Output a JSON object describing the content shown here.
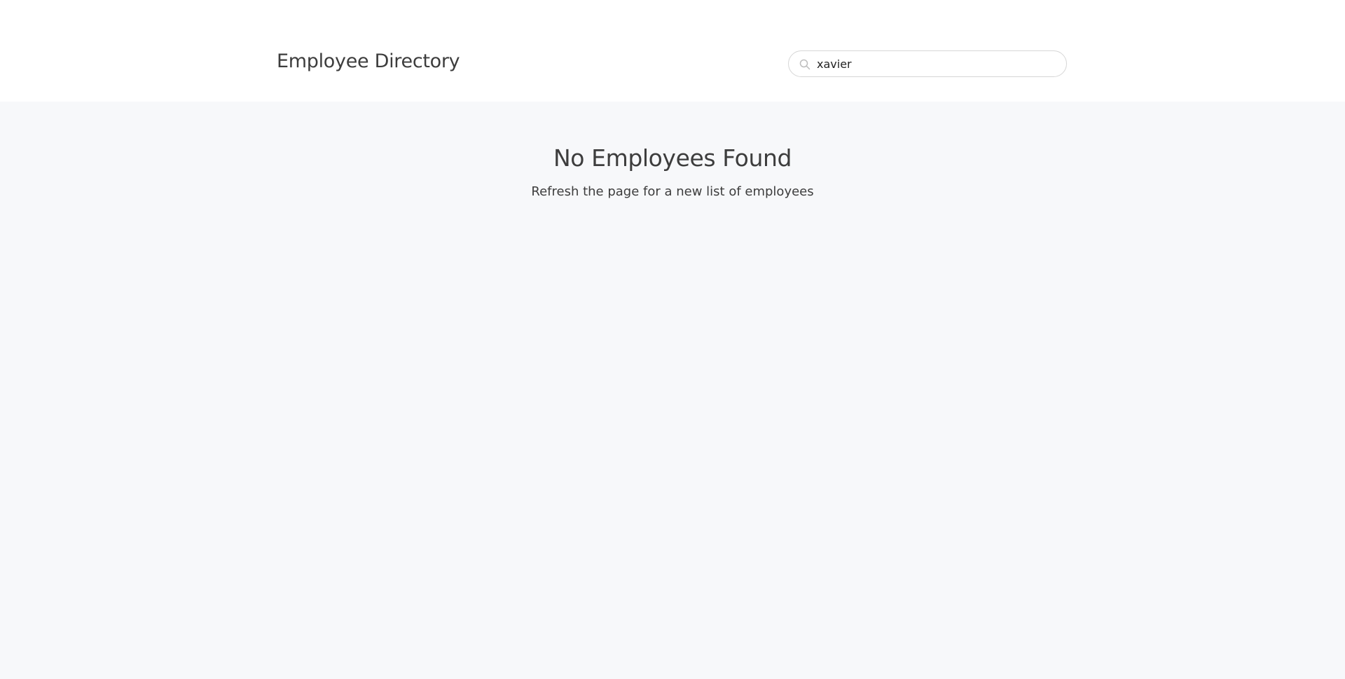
{
  "header": {
    "title": "Employee Directory",
    "search": {
      "value": "xavier",
      "placeholder": "",
      "icon": "search-icon"
    }
  },
  "main": {
    "empty_state": {
      "title": "No Employees Found",
      "subtitle": "Refresh the page for a new list of employees"
    }
  },
  "colors": {
    "header_background": "#ffffff",
    "page_background": "#f7f8fa",
    "text": "#3d3d3d",
    "input_border": "#d6d6d6"
  }
}
